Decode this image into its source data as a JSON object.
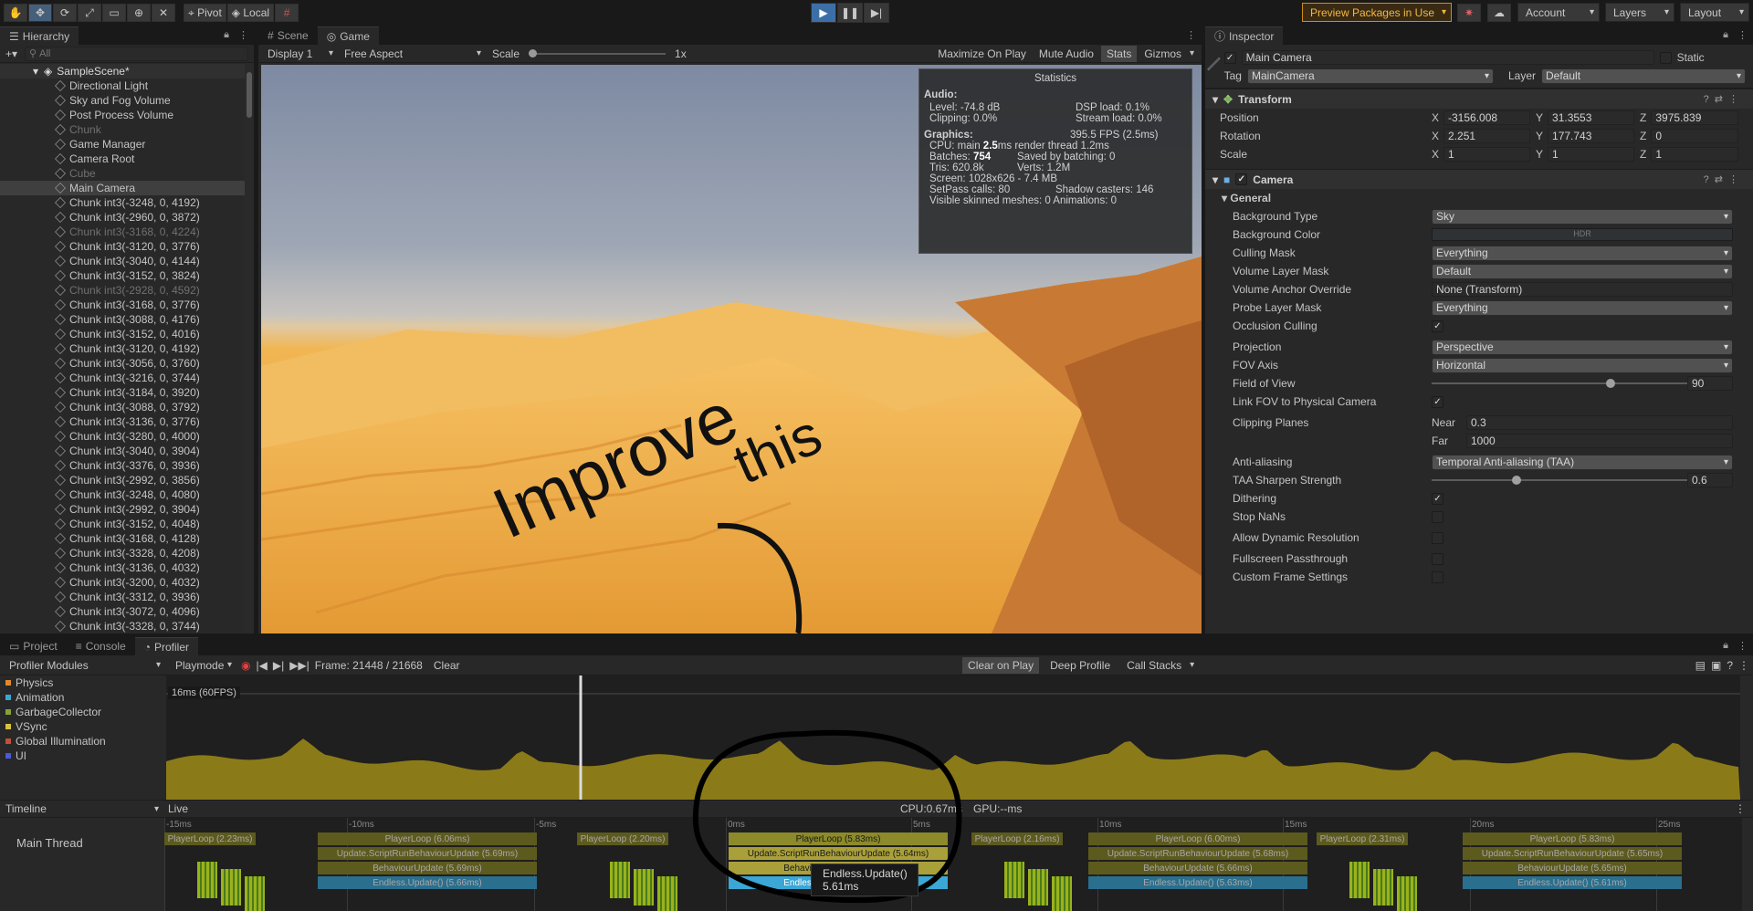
{
  "toolbar": {
    "pivot": "Pivot",
    "local": "Local",
    "preview": "Preview Packages in Use",
    "account": "Account",
    "layers": "Layers",
    "layout": "Layout"
  },
  "hierarchy": {
    "tab": "Hierarchy",
    "search_placeholder": "All",
    "scene": "SampleScene*",
    "items": [
      {
        "label": "Directional Light",
        "dim": false
      },
      {
        "label": "Sky and Fog Volume",
        "dim": false
      },
      {
        "label": "Post Process Volume",
        "dim": false
      },
      {
        "label": "Chunk",
        "dim": true
      },
      {
        "label": "Game Manager",
        "dim": false
      },
      {
        "label": "Camera Root",
        "dim": false
      },
      {
        "label": "Cube",
        "dim": true
      },
      {
        "label": "Main Camera",
        "dim": false,
        "selected": true
      },
      {
        "label": "Chunk int3(-3248, 0, 4192)",
        "dim": false
      },
      {
        "label": "Chunk int3(-2960, 0, 3872)",
        "dim": false
      },
      {
        "label": "Chunk int3(-3168, 0, 4224)",
        "dim": true
      },
      {
        "label": "Chunk int3(-3120, 0, 3776)",
        "dim": false
      },
      {
        "label": "Chunk int3(-3040, 0, 4144)",
        "dim": false
      },
      {
        "label": "Chunk int3(-3152, 0, 3824)",
        "dim": false
      },
      {
        "label": "Chunk int3(-2928, 0, 4592)",
        "dim": true
      },
      {
        "label": "Chunk int3(-3168, 0, 3776)",
        "dim": false
      },
      {
        "label": "Chunk int3(-3088, 0, 4176)",
        "dim": false
      },
      {
        "label": "Chunk int3(-3152, 0, 4016)",
        "dim": false
      },
      {
        "label": "Chunk int3(-3120, 0, 4192)",
        "dim": false
      },
      {
        "label": "Chunk int3(-3056, 0, 3760)",
        "dim": false
      },
      {
        "label": "Chunk int3(-3216, 0, 3744)",
        "dim": false
      },
      {
        "label": "Chunk int3(-3184, 0, 3920)",
        "dim": false
      },
      {
        "label": "Chunk int3(-3088, 0, 3792)",
        "dim": false
      },
      {
        "label": "Chunk int3(-3136, 0, 3776)",
        "dim": false
      },
      {
        "label": "Chunk int3(-3280, 0, 4000)",
        "dim": false
      },
      {
        "label": "Chunk int3(-3040, 0, 3904)",
        "dim": false
      },
      {
        "label": "Chunk int3(-3376, 0, 3936)",
        "dim": false
      },
      {
        "label": "Chunk int3(-2992, 0, 3856)",
        "dim": false
      },
      {
        "label": "Chunk int3(-3248, 0, 4080)",
        "dim": false
      },
      {
        "label": "Chunk int3(-2992, 0, 3904)",
        "dim": false
      },
      {
        "label": "Chunk int3(-3152, 0, 4048)",
        "dim": false
      },
      {
        "label": "Chunk int3(-3168, 0, 4128)",
        "dim": false
      },
      {
        "label": "Chunk int3(-3328, 0, 4208)",
        "dim": false
      },
      {
        "label": "Chunk int3(-3136, 0, 4032)",
        "dim": false
      },
      {
        "label": "Chunk int3(-3200, 0, 4032)",
        "dim": false
      },
      {
        "label": "Chunk int3(-3312, 0, 3936)",
        "dim": false
      },
      {
        "label": "Chunk int3(-3072, 0, 4096)",
        "dim": false
      },
      {
        "label": "Chunk int3(-3328, 0, 3744)",
        "dim": false
      }
    ]
  },
  "game": {
    "tab_scene": "Scene",
    "tab_game": "Game",
    "display": "Display 1",
    "aspect": "Free Aspect",
    "scale_label": "Scale",
    "scale_value": "1x",
    "maximize": "Maximize On Play",
    "mute": "Mute Audio",
    "stats": "Stats",
    "gizmos": "Gizmos",
    "annotation_1": "Improve",
    "annotation_2": "this"
  },
  "stats": {
    "title": "Statistics",
    "audio": "Audio:",
    "level": "Level: -74.8 dB",
    "dsp": "DSP load: 0.1%",
    "clipping": "Clipping: 0.0%",
    "stream": "Stream load: 0.0%",
    "graphics": "Graphics:",
    "fps": "395.5 FPS (2.5ms)",
    "cpu_pre": "CPU: main ",
    "cpu_main": "2.5",
    "cpu_post": "ms  render thread 1.2ms",
    "batches_pre": "Batches: ",
    "batches": "754",
    "batching": "Saved by batching: 0",
    "tris": "Tris: 620.8k",
    "verts": "Verts: 1.2M",
    "screen": "Screen: 1028x626 - 7.4 MB",
    "setpass": "SetPass calls: 80",
    "shadow": "Shadow casters: 146",
    "skinned": "Visible skinned meshes: 0  Animations: 0"
  },
  "inspector": {
    "tab": "Inspector",
    "object": "Main Camera",
    "static": "Static",
    "tag_label": "Tag",
    "tag": "MainCamera",
    "layer_label": "Layer",
    "layer": "Default",
    "transform": "Transform",
    "position": "Position",
    "rotation": "Rotation",
    "scale": "Scale",
    "pos": [
      "-3156.008",
      "31.3553",
      "3975.839"
    ],
    "rot": [
      "2.251",
      "177.743",
      "0"
    ],
    "scl": [
      "1",
      "1",
      "1"
    ],
    "camera": "Camera",
    "general": "General",
    "bg_type_label": "Background Type",
    "bg_type": "Sky",
    "bg_color_label": "Background Color",
    "hdr": "HDR",
    "culling_label": "Culling Mask",
    "culling": "Everything",
    "vlm_label": "Volume Layer Mask",
    "vlm": "Default",
    "vao_label": "Volume Anchor Override",
    "vao": "None (Transform)",
    "plm_label": "Probe Layer Mask",
    "plm": "Everything",
    "occ_label": "Occlusion Culling",
    "proj_label": "Projection",
    "proj": "Perspective",
    "fovaxis_label": "FOV Axis",
    "fovaxis": "Horizontal",
    "fov_label": "Field of View",
    "fov": "90",
    "fov_fraction": 0.65,
    "link_label": "Link FOV to Physical Camera",
    "clip_label": "Clipping Planes",
    "near_label": "Near",
    "near": "0.3",
    "far_label": "Far",
    "far": "1000",
    "aa_label": "Anti-aliasing",
    "aa": "Temporal Anti-aliasing (TAA)",
    "taa_label": "TAA Sharpen Strength",
    "taa": "0.6",
    "taa_fraction": 0.3,
    "dither_label": "Dithering",
    "nans_label": "Stop NaNs",
    "dyn_label": "Allow Dynamic Resolution",
    "full_label": "Fullscreen Passthrough",
    "custom_label": "Custom Frame Settings"
  },
  "profiler": {
    "tab_project": "Project",
    "tab_console": "Console",
    "tab_profiler": "Profiler",
    "modules": "Profiler Modules",
    "playmode": "Playmode",
    "frame": "Frame: 21448 / 21668",
    "clear": "Clear",
    "clear_on_play": "Clear on Play",
    "deep": "Deep Profile",
    "callstacks": "Call Stacks",
    "mods": [
      {
        "name": "Physics",
        "color": "#e08a2c"
      },
      {
        "name": "Animation",
        "color": "#3aa7d6"
      },
      {
        "name": "GarbageCollector",
        "color": "#86a238"
      },
      {
        "name": "VSync",
        "color": "#d8c23c"
      },
      {
        "name": "Global Illumination",
        "color": "#c0503a"
      },
      {
        "name": "UI",
        "color": "#4a5ad8"
      }
    ],
    "fps_marker": "16ms (60FPS)",
    "timeline": "Timeline",
    "live": "Live",
    "cpu": "CPU:0.67ms",
    "gpu": "GPU:--ms",
    "main_thread": "Main Thread",
    "ticks": [
      "-15ms",
      "-10ms",
      "-5ms",
      "0ms",
      "5ms",
      "10ms",
      "15ms",
      "20ms",
      "25ms"
    ],
    "frames": [
      {
        "pl": "PlayerLoop (6.06ms)",
        "up": "Update.ScriptRunBehaviourUpdate (5.69ms)",
        "bu": "BehaviourUpdate (5.69ms)",
        "eu": "Endless.Update() (5.66ms)"
      },
      {
        "pl": "PlayerLoop (5.83ms)",
        "up": "Update.ScriptRunBehaviourUpdate (5.64ms)",
        "bu": "BehaviourUpdate (5.64ms)",
        "eu": "Endless.Update() (5.61ms)"
      },
      {
        "pl": "PlayerLoop (6.00ms)",
        "up": "Update.ScriptRunBehaviourUpdate (5.68ms)",
        "bu": "BehaviourUpdate (5.66ms)",
        "eu": "Endless.Update() (5.63ms)"
      },
      {
        "pl": "PlayerLoop (5.83ms)",
        "up": "Update.ScriptRunBehaviourUpdate (5.65ms)",
        "bu": "BehaviourUpdate (5.65ms)",
        "eu": "Endless.Update() (5.61ms)"
      }
    ],
    "small": [
      "PlayerLoop (2.23ms)",
      "PlayerLoop (2.20ms)",
      "PlayerLoop (2.16ms)",
      "PlayerLoop (2.31ms)"
    ],
    "tooltip_name": "Endless.Update()",
    "tooltip_time": "5.61ms"
  }
}
